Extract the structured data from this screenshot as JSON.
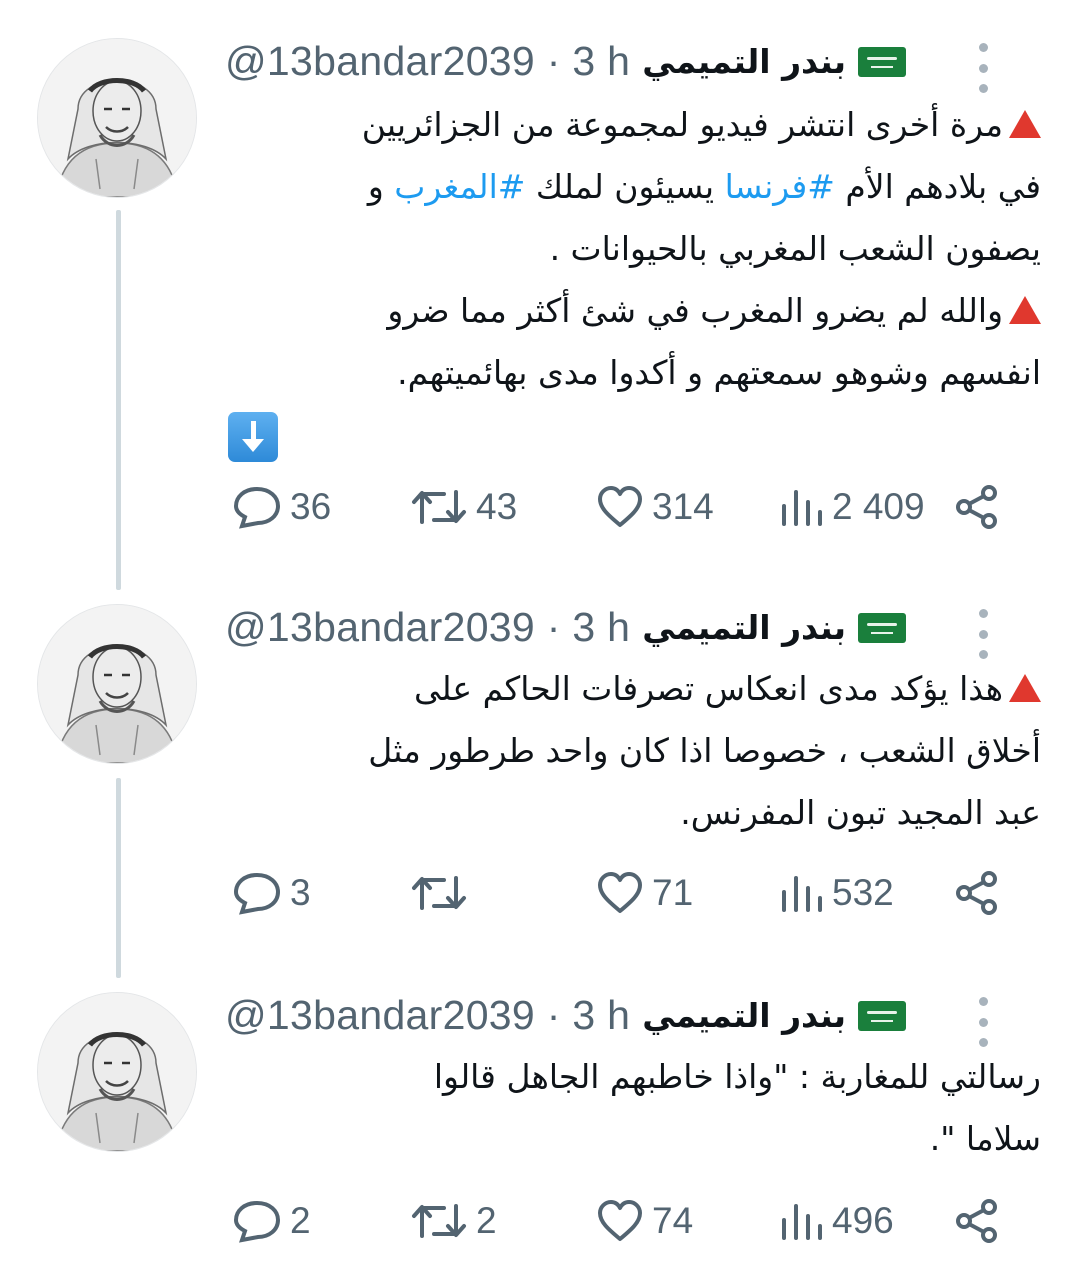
{
  "thread": {
    "tweets": [
      {
        "display_name": "بندر التميمي",
        "handle": "@13bandar2039",
        "time": "3 h",
        "text": {
          "l1": "مرة أخرى انتشر فيديو لمجموعة من الجزائريين",
          "l2a": "في بلادهم الأم ",
          "l2_hashtag1": "#فرنسا",
          "l2b": " يسيئون لملك ",
          "l2_hashtag2": "#المغرب",
          "l2c": " و",
          "l3": "يصفون الشعب المغربي بالحيوانات .",
          "l4": "والله لم يضرو المغرب في شئ أكثر مما ضرو",
          "l5": "انفسهم وشوهو سمعتهم و أكدوا مدى بهائميتهم."
        },
        "stats": {
          "replies": "36",
          "retweets": "43",
          "likes": "314",
          "views": "2 409"
        }
      },
      {
        "display_name": "بندر التميمي",
        "handle": "@13bandar2039",
        "time": "3 h",
        "text": {
          "l1": "هذا يؤكد مدى انعكاس تصرفات الحاكم على",
          "l2": "أخلاق الشعب ، خصوصا اذا كان واحد طرطور مثل",
          "l3": "عبد المجيد تبون المفرنس."
        },
        "stats": {
          "replies": "3",
          "retweets": "",
          "likes": "71",
          "views": "532"
        }
      },
      {
        "display_name": "بندر التميمي",
        "handle": "@13bandar2039",
        "time": "3 h",
        "text": {
          "l1": "رسالتي للمغاربة : \"واذا خاطبهم الجاهل قالوا",
          "l2": "سلاما \"."
        },
        "stats": {
          "replies": "2",
          "retweets": "2",
          "likes": "74",
          "views": "496"
        }
      }
    ]
  },
  "separator": "·",
  "icons": {
    "avatar": "avatar-sketch-man-ghutra",
    "flag": "saudi-flag",
    "warning": "red-triangle-icon",
    "down": "down-arrow-box-icon",
    "more": "more-vertical-icon",
    "reply": "reply-icon",
    "retweet": "retweet-icon",
    "like": "heart-icon",
    "views": "views-icon",
    "share": "share-icon"
  },
  "colors": {
    "link": "#1d9bf0",
    "muted": "#536471",
    "text": "#0f1419",
    "thread_line": "#cfd9de"
  }
}
